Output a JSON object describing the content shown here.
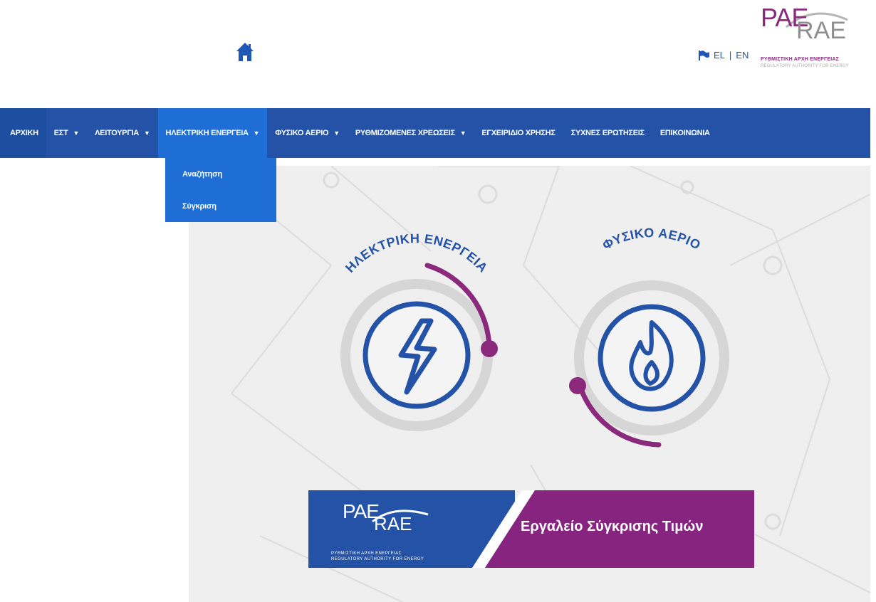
{
  "header": {
    "home_icon": "home-icon",
    "flag_icon": "flag-icon",
    "lang_el": "EL",
    "lang_sep": "|",
    "lang_en": "EN",
    "logo": {
      "pae": "PAE",
      "rae": "RAE",
      "subtitle_el": "ΡΥΘΜΙΣΤΙΚΗ ΑΡΧΗ ΕΝΕΡΓΕΙΑΣ",
      "subtitle_en": "REGULATORY AUTHORITY FOR ENERGY"
    }
  },
  "nav": {
    "items": [
      {
        "label": "ΑΡΧΙΚΗ",
        "caret": ""
      },
      {
        "label": "ΕΣΤ",
        "caret": "▼"
      },
      {
        "label": "ΛΕΙΤΟΥΡΓΙΑ",
        "caret": "▼"
      },
      {
        "label": "ΗΛΕΚΤΡΙΚΗ ΕΝΕΡΓΕΙΑ",
        "caret": "▼"
      },
      {
        "label": "ΦΥΣΙΚΟ ΑΕΡΙΟ",
        "caret": "▼"
      },
      {
        "label": "ΡΥΘΜΙΖΟΜΕΝΕΣ ΧΡΕΩΣΕΙΣ",
        "caret": "▼"
      },
      {
        "label": "ΕΓΧΕΙΡΙΔΙΟ ΧΡΗΣΗΣ",
        "caret": ""
      },
      {
        "label": "ΣΥΧΝΕΣ ΕΡΩΤΗΣΕΙΣ",
        "caret": ""
      },
      {
        "label": "ΕΠΙΚΟΙΝΩΝΙΑ",
        "caret": ""
      }
    ],
    "dropdown": [
      "Αναζήτηση",
      "Σύγκριση"
    ]
  },
  "hero": {
    "left_label": "ΗΛΕΚΤΡΙΚΗ ΕΝΕΡΓΕΙΑ",
    "right_label": "ΦΥΣΙΚΟ ΑΕΡΙΟ",
    "left_icon": "lightning-bolt-icon",
    "right_icon": "flame-icon",
    "banner_title": "Εργαλείο Σύγκρισης Τιμών",
    "banner_logo": {
      "pae": "PAE",
      "rae": "RAE",
      "subtitle_el": "ΡΥΘΜΙΣΤΙΚΗ ΑΡΧΗ ΕΝΕΡΓΕΙΑΣ",
      "subtitle_en": "REGULATORY AUTHORITY FOR ENERGY"
    }
  },
  "colors": {
    "nav_blue": "#2352a6",
    "nav_active": "#1e6ed6",
    "brand_purple": "#8b2a7d",
    "icon_blue": "#2352a6",
    "ring_gray": "#cfcfcf"
  }
}
